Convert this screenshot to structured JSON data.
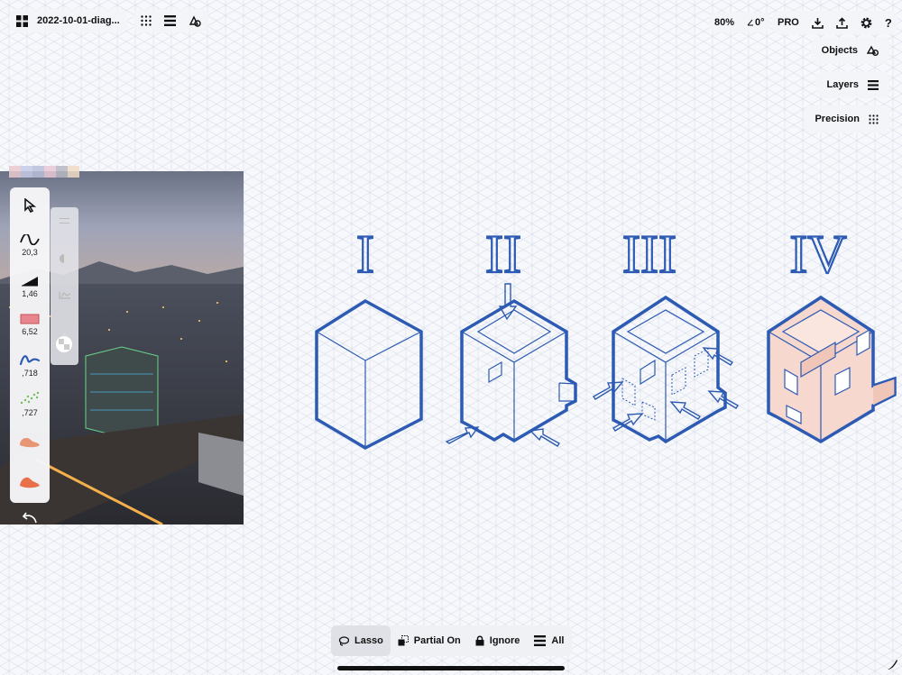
{
  "toolbar": {
    "file_title": "2022-10-01-diag...",
    "zoom": "80%",
    "angle": "0°",
    "pro_label": "PRO"
  },
  "side_panel": {
    "objects_label": "Objects",
    "layers_label": "Layers",
    "precision_label": "Precision"
  },
  "tools": [
    {
      "name": "select-tool",
      "value": ""
    },
    {
      "name": "curve-tool",
      "value": "20,3"
    },
    {
      "name": "triangle-tool",
      "value": "1,46"
    },
    {
      "name": "rect-tool",
      "value": "6,52"
    },
    {
      "name": "pen-tool",
      "value": ",718"
    },
    {
      "name": "spray-tool",
      "value": ",727"
    },
    {
      "name": "brush-tool",
      "value": ""
    },
    {
      "name": "fill-tool",
      "value": ""
    }
  ],
  "diagram": {
    "labels": [
      "I",
      "II",
      "III",
      "IV"
    ],
    "stroke_color": "#2d5bb3",
    "fill_color": "#f6d8cf"
  },
  "bottom_bar": {
    "lasso_label": "Lasso",
    "partial_label": "Partial On",
    "ignore_label": "Ignore",
    "all_label": "All"
  },
  "colors": {
    "canvas_bg": "#f7f8fb",
    "grid_line": "#d7dde9",
    "accent_blue": "#2d5bb3",
    "accent_orange": "#e8704a"
  }
}
